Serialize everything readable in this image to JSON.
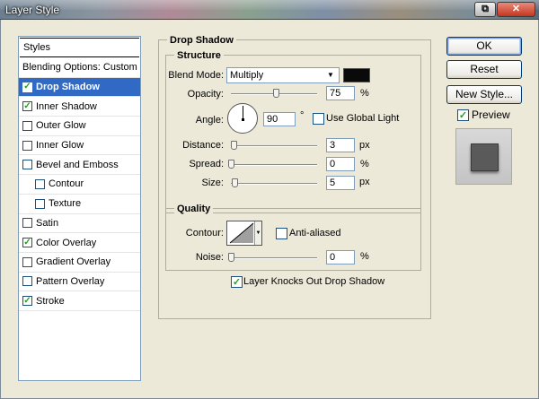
{
  "window": {
    "title": "Layer Style"
  },
  "styles_panel": {
    "header": "Styles",
    "items": [
      {
        "label": "Blending Options: Custom",
        "checkbox": false,
        "checked": false,
        "indent": false,
        "selected": false
      },
      {
        "label": "Drop Shadow",
        "checkbox": true,
        "checked": true,
        "indent": false,
        "selected": true
      },
      {
        "label": "Inner Shadow",
        "checkbox": true,
        "checked": true,
        "indent": false,
        "selected": false
      },
      {
        "label": "Outer Glow",
        "checkbox": true,
        "checked": false,
        "indent": false,
        "selected": false
      },
      {
        "label": "Inner Glow",
        "checkbox": true,
        "checked": false,
        "indent": false,
        "selected": false
      },
      {
        "label": "Bevel and Emboss",
        "checkbox": true,
        "checked": false,
        "indent": false,
        "selected": false
      },
      {
        "label": "Contour",
        "checkbox": true,
        "checked": false,
        "indent": true,
        "selected": false
      },
      {
        "label": "Texture",
        "checkbox": true,
        "checked": false,
        "indent": true,
        "selected": false
      },
      {
        "label": "Satin",
        "checkbox": true,
        "checked": false,
        "indent": false,
        "selected": false
      },
      {
        "label": "Color Overlay",
        "checkbox": true,
        "checked": true,
        "indent": false,
        "selected": false
      },
      {
        "label": "Gradient Overlay",
        "checkbox": true,
        "checked": false,
        "indent": false,
        "selected": false
      },
      {
        "label": "Pattern Overlay",
        "checkbox": true,
        "checked": false,
        "indent": false,
        "selected": false
      },
      {
        "label": "Stroke",
        "checkbox": true,
        "checked": true,
        "indent": false,
        "selected": false
      }
    ]
  },
  "drop_shadow": {
    "section_title": "Drop Shadow",
    "structure": {
      "title": "Structure",
      "blend_mode_label": "Blend Mode:",
      "blend_mode_value": "Multiply",
      "shadow_color": "#0a0a0a",
      "opacity_label": "Opacity:",
      "opacity_value": "75",
      "opacity_unit": "%",
      "opacity_level": 0.75,
      "angle_label": "Angle:",
      "angle_value": "90",
      "angle_unit": "°",
      "use_global_light_label": "Use Global Light",
      "use_global_light_checked": false,
      "distance_label": "Distance:",
      "distance_value": "3",
      "distance_unit": "px",
      "spread_label": "Spread:",
      "spread_value": "0",
      "spread_unit": "%",
      "size_label": "Size:",
      "size_value": "5",
      "size_unit": "px"
    },
    "quality": {
      "title": "Quality",
      "contour_label": "Contour:",
      "anti_aliased_label": "Anti-aliased",
      "anti_aliased_checked": false,
      "noise_label": "Noise:",
      "noise_value": "0",
      "noise_unit": "%"
    },
    "knockout_label": "Layer Knocks Out Drop Shadow",
    "knockout_checked": true
  },
  "buttons": {
    "ok": "OK",
    "reset": "Reset",
    "new_style": "New Style...",
    "preview_label": "Preview",
    "preview_checked": true
  },
  "colors": {
    "selection": "#316ac5",
    "dialog_bg": "#ece9d8",
    "preview_swatch": "#5a5a5a"
  }
}
